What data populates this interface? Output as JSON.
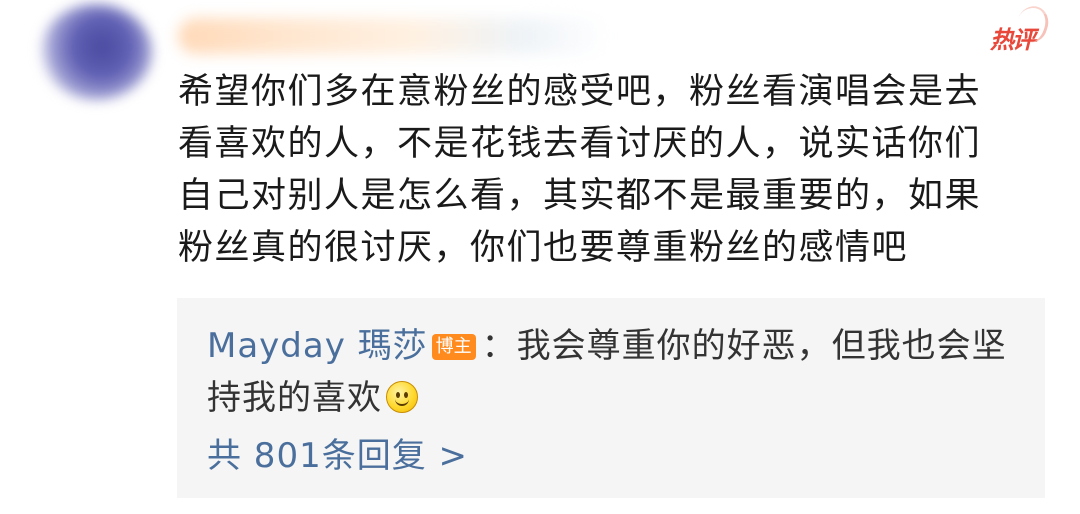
{
  "hot_badge": "热评",
  "comment": {
    "lines": [
      "希望你们多在意粉丝的感受吧，粉丝看演唱会是去",
      "看喜欢的人，不是花钱去看讨厌的人，说实话你们",
      "自己对别人是怎么看，其实都不是最重要的，如果",
      "粉丝真的很讨厌，你们也要尊重粉丝的感情吧"
    ]
  },
  "reply": {
    "author": "Mayday 瑪莎",
    "author_badge": "博主",
    "separator": "：",
    "text_line1": "我会尊重你的好恶，但我也会坚",
    "text_line2": "持我的喜欢",
    "emoji": "smiley-face-icon",
    "count_label": "共 801条回复 >"
  },
  "colors": {
    "link_blue": "#4a6f9c",
    "hot_red": "#e8473a",
    "badge_orange": "#ff8a1e",
    "reply_bg": "#f5f5f5"
  }
}
